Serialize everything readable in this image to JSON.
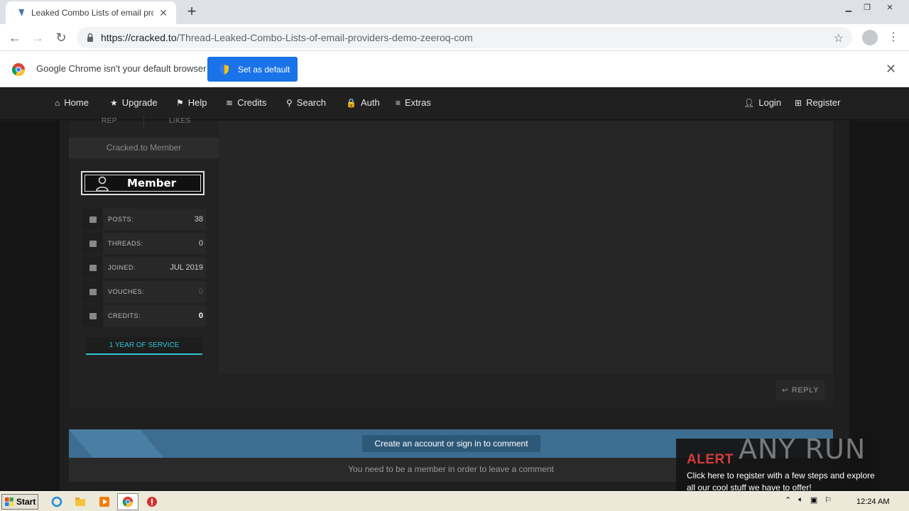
{
  "browser": {
    "tab_title": "Leaked Combo Lists of email provider",
    "url_domain": "https://cracked.to",
    "url_path": "/Thread-Leaked-Combo-Lists-of-email-providers-demo-zeeroq-com",
    "infobar_message": "Google Chrome isn't your default browser",
    "set_default_label": "Set as default"
  },
  "nav": {
    "items": [
      {
        "label": "Home",
        "icon": "⌂"
      },
      {
        "label": "Upgrade",
        "icon": "★"
      },
      {
        "label": "Help",
        "icon": "⚑"
      },
      {
        "label": "Credits",
        "icon": "≋"
      },
      {
        "label": "Search",
        "icon": "⚲"
      },
      {
        "label": "Auth",
        "icon": "🔒"
      },
      {
        "label": "Extras",
        "icon": "≡"
      }
    ],
    "login_label": "Login",
    "register_label": "Register"
  },
  "user": {
    "rep_label": "REP",
    "likes_label": "LIKES",
    "title": "Cracked.to Member",
    "badge": "Member",
    "stats": [
      {
        "label": "POSTS:",
        "value": "38"
      },
      {
        "label": "THREADS:",
        "value": "0"
      },
      {
        "label": "JOINED:",
        "value": "JUL 2019"
      },
      {
        "label": "VOUCHES:",
        "value": "0"
      },
      {
        "label": "CREDITS:",
        "value": "0"
      }
    ],
    "service": "1 YEAR OF SERVICE"
  },
  "post": {
    "reply_label": "REPLY"
  },
  "comment": {
    "button": "Create an account or sign in to comment",
    "subtext": "You need to be a member in order to leave a comment"
  },
  "overlay": {
    "alert_title": "ALERT",
    "alert_body": "Click here to register with a few steps and explore all our cool stuff we have to offer!",
    "watermark": "ANY RUN"
  },
  "taskbar": {
    "start_label": "Start",
    "clock": "12:24 AM"
  },
  "colors": {
    "accent": "#1a73e8",
    "service": "#2ec4d6",
    "alert": "#d63b3b",
    "comment_bar": "#3d6e91"
  }
}
